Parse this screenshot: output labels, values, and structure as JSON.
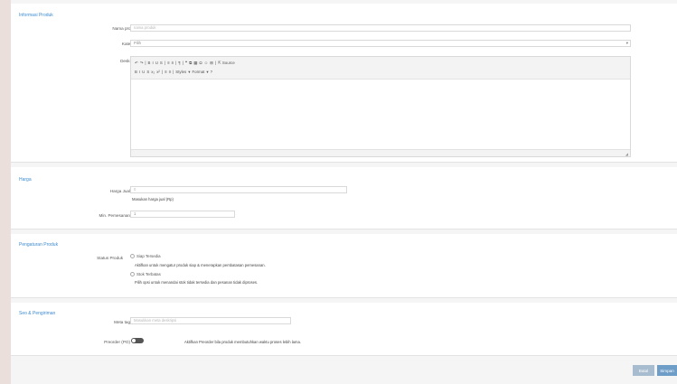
{
  "sections": {
    "informasi_produk": "Informasi Produk",
    "harga": "Harga",
    "pengaturan_produk": "Pengaturan Produk",
    "seo": "Seo & Pengiriman"
  },
  "fields": {
    "nama_produk_label": "Nama produk",
    "nama_produk_placeholder": "nama produk",
    "kategori_label": "Kategori",
    "kategori_value": "Pilih",
    "deskripsi_label": "Deskripsi",
    "toolbar_row1": [
      "↶",
      "↷",
      "|",
      "B",
      "I",
      "U",
      "S",
      "|",
      "≡",
      "≡",
      "|",
      "¶",
      "|",
      "❝",
      "⧉",
      "▦",
      "Ω",
      "☺",
      "⊞",
      "|",
      "⇱ Source"
    ],
    "toolbar_row2": [
      "B",
      "I",
      "U",
      "S",
      "x₂",
      "x²",
      "|",
      "≡",
      "≡",
      "|",
      "Styles",
      "▾",
      "Format",
      "▾",
      "?"
    ],
    "harga_jual_label": "Harga Jual",
    "harga_jual_placeholder": "0",
    "harga_hint": "Masukan harga jual (Rp)",
    "min_pemesanan_label": "Min. Pemesanan",
    "min_pemesanan_value": "1",
    "status_produk_label": "Status Produk",
    "status_opt1": "Siap Tersedia",
    "status_opt1_hint": "Aktifkan untuk mengatur produk siap & menerapkan pembatasan pemesanan.",
    "status_opt2": "Stok Terbatas",
    "status_opt2_hint": "Pilih opsi untuk menandai stok tidak tersedia dan pesanan tidak diproses.",
    "meta_label": "Meta tag",
    "meta_placeholder": "Masukkan meta deskripsi",
    "preorder_label": "Preorder (PO)",
    "preorder_hint": "Aktifkan Preorder bila produk membutuhkan waktu proses lebih lama."
  },
  "buttons": {
    "back": "Batal",
    "save": "Simpan"
  },
  "colors": {
    "accent": "#3d8bcf",
    "button_back": "#a8bccf",
    "button_save": "#6e9dc7"
  }
}
